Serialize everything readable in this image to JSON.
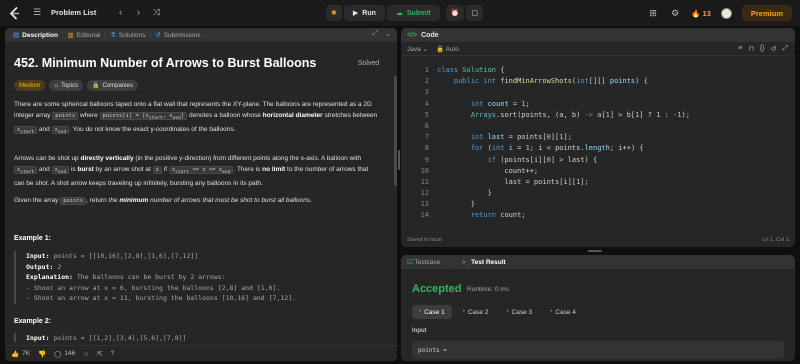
{
  "topbar": {
    "problem_list": "Problem List",
    "run_label": "Run",
    "submit_label": "Submit",
    "streak": "13",
    "premium": "Premium"
  },
  "left_tabs": {
    "description": "Description",
    "editorial": "Editorial",
    "solutions": "Solutions",
    "submissions": "Submissions"
  },
  "problem": {
    "title": "452. Minimum Number of Arrows to Burst Balloons",
    "status": "Solved",
    "difficulty": "Medium",
    "topics": "Topics",
    "companies": "Companies",
    "p1_a": "There are some spherical balloons taped onto a flat wall that represents the XY-plane. The balloons are represented as a 2D integer array ",
    "p1_code1": "points",
    "p1_b": " where ",
    "p1_code2": "points[i] = [x",
    "p1_code2_sub": "start",
    "p1_code2b": ", x",
    "p1_code2b_sub": "end",
    "p1_code2c": "]",
    "p1_c": " denotes a balloon whose ",
    "p1_bold": "horizontal diameter",
    "p1_d": " stretches between ",
    "p1_code3": "x",
    "p1_code3_sub": "start",
    "p1_e": " and ",
    "p1_code4": "x",
    "p1_code4_sub": "end",
    "p1_f": ". You do not know the exact y-coordinates of the balloons.",
    "p2_a": "Arrows can be shot up ",
    "p2_bold1": "directly vertically",
    "p2_b": " (in the positive y-direction) from different points along the x-axis. A balloon with ",
    "p2_code1": "x",
    "p2_code1_sub": "start",
    "p2_c": " and ",
    "p2_code2": "x",
    "p2_code2_sub": "end",
    "p2_d": " is ",
    "p2_bold2": "burst",
    "p2_e": " by an arrow shot at ",
    "p2_code3": "x",
    "p2_f": " if ",
    "p2_code4": "x",
    "p2_code4_sub": "start",
    "p2_code4b": " <= x <= x",
    "p2_code4b_sub": "end",
    "p2_g": ". There is ",
    "p2_bold3": "no limit",
    "p2_h": " to the number of arrows that can be shot. A shot arrow keeps traveling up infinitely, bursting any balloons in its path.",
    "p3_a": "Given the array ",
    "p3_code": "points",
    "p3_b": ", return ",
    "p3_italic_a": "the ",
    "p3_bold": "minimum",
    "p3_italic_b": " number of arrows that must be shot to burst all balloons",
    "p3_c": ".",
    "ex1_title": "Example 1:",
    "ex1_input_label": "Input:",
    "ex1_input": " points = [[10,16],[2,8],[1,6],[7,12]]",
    "ex1_output_label": "Output:",
    "ex1_output": " 2",
    "ex1_expl_label": "Explanation:",
    "ex1_expl": " The balloons can be burst by 2 arrows:",
    "ex1_l1": "- Shoot an arrow at x = 6, bursting the balloons [2,8] and [1,6].",
    "ex1_l2": "- Shoot an arrow at x = 11, bursting the balloons [10,16] and [7,12].",
    "ex2_title": "Example 2:",
    "ex2_input_label": "Input:",
    "ex2_input": " points = [[1,2],[3,4],[5,6],[7,8]]"
  },
  "footer": {
    "likes": "7K",
    "comments": "146"
  },
  "code_panel": {
    "title": "Code",
    "language": "Java",
    "auto": "Auto",
    "saved": "Saved to local",
    "cursor": "Ln 1, Col 1",
    "lines": [
      "1",
      "2",
      "3",
      "4",
      "5",
      "6",
      "7",
      "8",
      "9",
      "10",
      "11",
      "12",
      "13",
      "14"
    ]
  },
  "test_panel": {
    "testcase_tab": "Testcase",
    "result_tab": "Test Result",
    "accepted": "Accepted",
    "runtime": "Runtime: 0 ms",
    "case1": "Case 1",
    "case2": "Case 2",
    "case3": "Case 3",
    "case4": "Case 4",
    "input_label": "Input",
    "input_value": "points ="
  },
  "colors": {
    "accent_orange": "#ffa116",
    "accepted_green": "#2cbb5d",
    "medium_yellow": "#ffb800"
  }
}
